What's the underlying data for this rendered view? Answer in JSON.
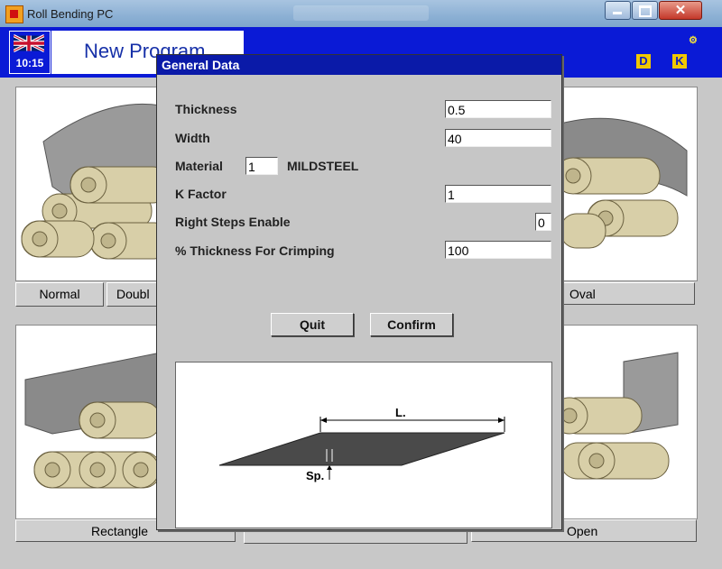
{
  "window": {
    "title": "Roll Bending PC"
  },
  "header": {
    "time": "10:15",
    "program_title": "New Program"
  },
  "shapes": {
    "normal": "Normal",
    "double": "Doubl",
    "oval": "Oval",
    "rectangle": "Rectangle",
    "open": "Open"
  },
  "dialog": {
    "title": "General Data",
    "thickness": {
      "label": "Thickness",
      "value": "0.5"
    },
    "width": {
      "label": "Width",
      "value": "40"
    },
    "material": {
      "label": "Material",
      "value": "1",
      "name": "MILDSTEEL"
    },
    "k_factor": {
      "label": "K Factor",
      "value": "1"
    },
    "right_steps": {
      "label": "Right Steps Enable",
      "value": "0"
    },
    "crimping": {
      "label": "% Thickness For Crimping",
      "value": "100"
    },
    "quit_label": "Quit",
    "confirm_label": "Confirm",
    "diagram": {
      "length_label": "L.",
      "thickness_label": "Sp."
    }
  },
  "colors": {
    "header_blue": "#0a1ad6",
    "dialog_title_blue": "#0a1aa8",
    "roller_tan": "#d8cfa8",
    "sheet_grey": "#8a8a8a"
  }
}
